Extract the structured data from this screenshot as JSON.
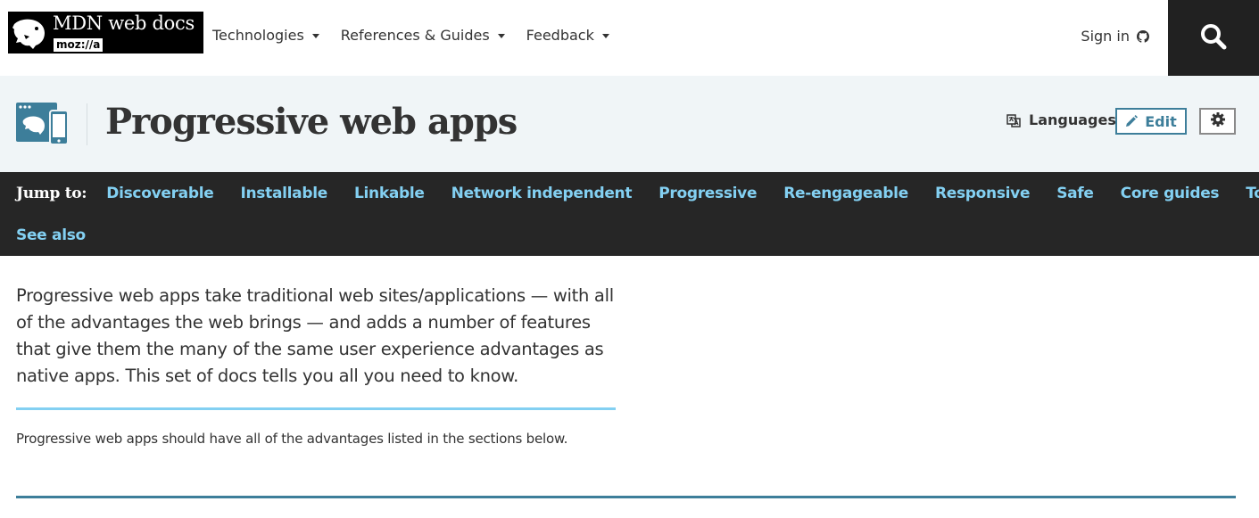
{
  "header": {
    "logo": {
      "title": "MDN web docs",
      "badge": "moz://a"
    },
    "nav": [
      {
        "label": "Technologies"
      },
      {
        "label": "References & Guides"
      },
      {
        "label": "Feedback"
      }
    ],
    "sign_in": "Sign in",
    "search_icon": "search-icon"
  },
  "title_band": {
    "title": "Progressive web apps",
    "languages_label": "Languages",
    "edit_label": "Edit",
    "settings_icon": "gear-icon"
  },
  "jump_to": {
    "label": "Jump to:",
    "links": [
      "Discoverable",
      "Installable",
      "Linkable",
      "Network independent",
      "Progressive",
      "Re-engageable",
      "Responsive",
      "Safe",
      "Core guides",
      "Tools",
      "See also"
    ]
  },
  "content": {
    "intro": "Progressive web apps take traditional web sites/applications — with all of the advantages the web brings — and adds a number of features that give them the many of the same user experience advantages as native apps. This set of docs tells you all you need to know.",
    "summary": "Progressive web apps should have all of the advantages listed in the sections below."
  },
  "colors": {
    "accent_link": "#83d0f2",
    "edit_border": "#3d7e9a",
    "jump_bar_bg": "#262626",
    "title_band_bg": "#f0f5f7",
    "search_bg": "#212121"
  }
}
